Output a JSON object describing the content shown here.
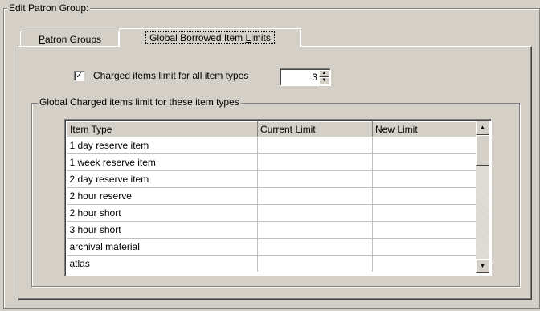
{
  "group_title": "Edit  Patron Group:",
  "tabs": [
    {
      "label": "Patron Groups",
      "active": false
    },
    {
      "label": "Global Borrowed Item Limits",
      "active": true
    }
  ],
  "charged_limit": {
    "checked": true,
    "label": "Charged items limit for all item types",
    "value": "3"
  },
  "inner_group_title": "Global Charged items limit for these item types",
  "grid": {
    "columns": [
      "Item Type",
      "Current Limit",
      "New Limit"
    ],
    "rows": [
      [
        "1 day reserve item",
        "",
        ""
      ],
      [
        "1 week reserve item",
        "",
        ""
      ],
      [
        "2 day reserve item",
        "",
        ""
      ],
      [
        "2 hour reserve",
        "",
        ""
      ],
      [
        "2 hour short",
        "",
        ""
      ],
      [
        "3 hour short",
        "",
        ""
      ],
      [
        "archival material",
        "",
        ""
      ],
      [
        "atlas",
        "",
        ""
      ]
    ]
  },
  "icons": {
    "checkbox": "✓",
    "spin_up": "▲",
    "spin_down": "▼",
    "scroll_up": "▲",
    "scroll_down": "▼"
  }
}
